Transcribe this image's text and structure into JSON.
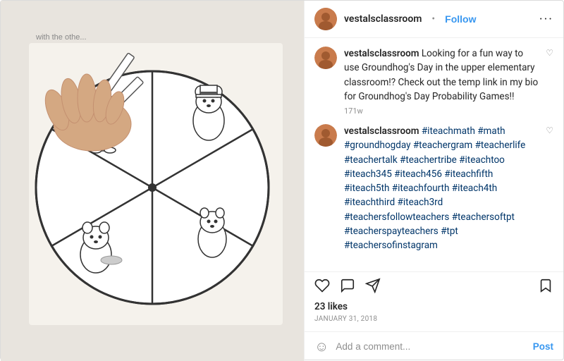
{
  "header": {
    "username": "vestalsclassroom",
    "dot": "•",
    "follow_label": "Follow",
    "more_icon": "•••"
  },
  "comments": [
    {
      "id": "main-caption",
      "username": "vestalsclassroom",
      "text": "Looking for a fun way to use Groundhog's Day in the upper elementary classroom!? Check out the temp link in my bio for Groundhog's Day Probability Games!!",
      "time": "171w",
      "show_heart": true
    },
    {
      "id": "hashtags",
      "username": "vestalsclassroom",
      "text": "#iteachmath #math #groundhogday #teachergram #teacherlife #teachertalk #teachertribe #iteachtoo #iteach345 #iteach456 #iteachfifth #iteach5th #iteachfourth #iteach4th #iteachthird #iteach3rd #teachersfollowteachers #teachersoftpt #teacherspayteachers #tpt #teachersofinstagram",
      "time": "",
      "show_heart": true
    }
  ],
  "actions": {
    "like_icon": "♡",
    "comment_icon": "💬",
    "share_icon": "➤",
    "bookmark_icon": "🔖",
    "likes_label": "23 likes",
    "post_date": "January 31, 2018"
  },
  "add_comment": {
    "smiley": "☺",
    "placeholder": "Add a comment...",
    "post_label": "Post"
  }
}
